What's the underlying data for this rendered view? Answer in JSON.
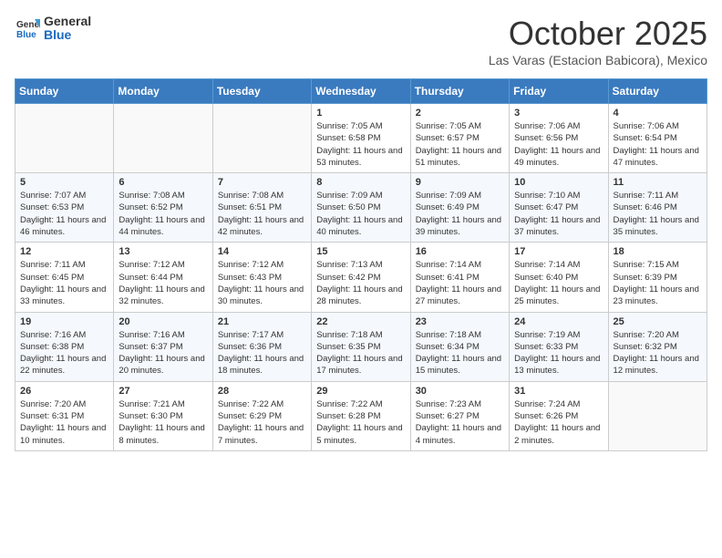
{
  "header": {
    "logo_general": "General",
    "logo_blue": "Blue",
    "month_title": "October 2025",
    "location": "Las Varas (Estacion Babicora), Mexico"
  },
  "weekdays": [
    "Sunday",
    "Monday",
    "Tuesday",
    "Wednesday",
    "Thursday",
    "Friday",
    "Saturday"
  ],
  "weeks": [
    [
      {
        "day": "",
        "info": ""
      },
      {
        "day": "",
        "info": ""
      },
      {
        "day": "",
        "info": ""
      },
      {
        "day": "1",
        "info": "Sunrise: 7:05 AM\nSunset: 6:58 PM\nDaylight: 11 hours and 53 minutes."
      },
      {
        "day": "2",
        "info": "Sunrise: 7:05 AM\nSunset: 6:57 PM\nDaylight: 11 hours and 51 minutes."
      },
      {
        "day": "3",
        "info": "Sunrise: 7:06 AM\nSunset: 6:56 PM\nDaylight: 11 hours and 49 minutes."
      },
      {
        "day": "4",
        "info": "Sunrise: 7:06 AM\nSunset: 6:54 PM\nDaylight: 11 hours and 47 minutes."
      }
    ],
    [
      {
        "day": "5",
        "info": "Sunrise: 7:07 AM\nSunset: 6:53 PM\nDaylight: 11 hours and 46 minutes."
      },
      {
        "day": "6",
        "info": "Sunrise: 7:08 AM\nSunset: 6:52 PM\nDaylight: 11 hours and 44 minutes."
      },
      {
        "day": "7",
        "info": "Sunrise: 7:08 AM\nSunset: 6:51 PM\nDaylight: 11 hours and 42 minutes."
      },
      {
        "day": "8",
        "info": "Sunrise: 7:09 AM\nSunset: 6:50 PM\nDaylight: 11 hours and 40 minutes."
      },
      {
        "day": "9",
        "info": "Sunrise: 7:09 AM\nSunset: 6:49 PM\nDaylight: 11 hours and 39 minutes."
      },
      {
        "day": "10",
        "info": "Sunrise: 7:10 AM\nSunset: 6:47 PM\nDaylight: 11 hours and 37 minutes."
      },
      {
        "day": "11",
        "info": "Sunrise: 7:11 AM\nSunset: 6:46 PM\nDaylight: 11 hours and 35 minutes."
      }
    ],
    [
      {
        "day": "12",
        "info": "Sunrise: 7:11 AM\nSunset: 6:45 PM\nDaylight: 11 hours and 33 minutes."
      },
      {
        "day": "13",
        "info": "Sunrise: 7:12 AM\nSunset: 6:44 PM\nDaylight: 11 hours and 32 minutes."
      },
      {
        "day": "14",
        "info": "Sunrise: 7:12 AM\nSunset: 6:43 PM\nDaylight: 11 hours and 30 minutes."
      },
      {
        "day": "15",
        "info": "Sunrise: 7:13 AM\nSunset: 6:42 PM\nDaylight: 11 hours and 28 minutes."
      },
      {
        "day": "16",
        "info": "Sunrise: 7:14 AM\nSunset: 6:41 PM\nDaylight: 11 hours and 27 minutes."
      },
      {
        "day": "17",
        "info": "Sunrise: 7:14 AM\nSunset: 6:40 PM\nDaylight: 11 hours and 25 minutes."
      },
      {
        "day": "18",
        "info": "Sunrise: 7:15 AM\nSunset: 6:39 PM\nDaylight: 11 hours and 23 minutes."
      }
    ],
    [
      {
        "day": "19",
        "info": "Sunrise: 7:16 AM\nSunset: 6:38 PM\nDaylight: 11 hours and 22 minutes."
      },
      {
        "day": "20",
        "info": "Sunrise: 7:16 AM\nSunset: 6:37 PM\nDaylight: 11 hours and 20 minutes."
      },
      {
        "day": "21",
        "info": "Sunrise: 7:17 AM\nSunset: 6:36 PM\nDaylight: 11 hours and 18 minutes."
      },
      {
        "day": "22",
        "info": "Sunrise: 7:18 AM\nSunset: 6:35 PM\nDaylight: 11 hours and 17 minutes."
      },
      {
        "day": "23",
        "info": "Sunrise: 7:18 AM\nSunset: 6:34 PM\nDaylight: 11 hours and 15 minutes."
      },
      {
        "day": "24",
        "info": "Sunrise: 7:19 AM\nSunset: 6:33 PM\nDaylight: 11 hours and 13 minutes."
      },
      {
        "day": "25",
        "info": "Sunrise: 7:20 AM\nSunset: 6:32 PM\nDaylight: 11 hours and 12 minutes."
      }
    ],
    [
      {
        "day": "26",
        "info": "Sunrise: 7:20 AM\nSunset: 6:31 PM\nDaylight: 11 hours and 10 minutes."
      },
      {
        "day": "27",
        "info": "Sunrise: 7:21 AM\nSunset: 6:30 PM\nDaylight: 11 hours and 8 minutes."
      },
      {
        "day": "28",
        "info": "Sunrise: 7:22 AM\nSunset: 6:29 PM\nDaylight: 11 hours and 7 minutes."
      },
      {
        "day": "29",
        "info": "Sunrise: 7:22 AM\nSunset: 6:28 PM\nDaylight: 11 hours and 5 minutes."
      },
      {
        "day": "30",
        "info": "Sunrise: 7:23 AM\nSunset: 6:27 PM\nDaylight: 11 hours and 4 minutes."
      },
      {
        "day": "31",
        "info": "Sunrise: 7:24 AM\nSunset: 6:26 PM\nDaylight: 11 hours and 2 minutes."
      },
      {
        "day": "",
        "info": ""
      }
    ]
  ]
}
